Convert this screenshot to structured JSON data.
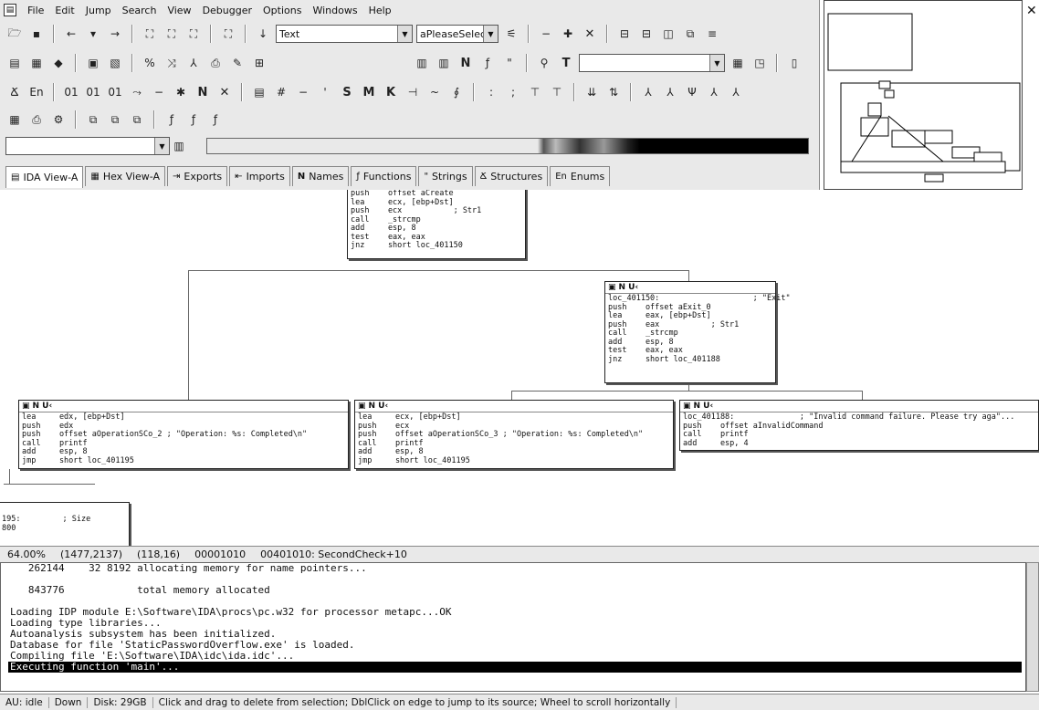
{
  "menu": [
    "File",
    "Edit",
    "Jump",
    "Search",
    "View",
    "Debugger",
    "Options",
    "Windows",
    "Help"
  ],
  "toolbar": {
    "text_combo": "Text",
    "select_combo": "aPleaseSelect"
  },
  "tabs": [
    {
      "label": "IDA View-A",
      "icon": "view-icon",
      "glyph": "▤"
    },
    {
      "label": "Hex View-A",
      "icon": "hex-icon",
      "glyph": "▦"
    },
    {
      "label": "Exports",
      "icon": "exports-icon",
      "glyph": "⇥"
    },
    {
      "label": "Imports",
      "icon": "imports-icon",
      "glyph": "⇤"
    },
    {
      "label": "Names",
      "icon": "names-icon",
      "glyph": "N"
    },
    {
      "label": "Functions",
      "icon": "functions-icon",
      "glyph": "ƒ"
    },
    {
      "label": "Strings",
      "icon": "strings-icon",
      "glyph": "\""
    },
    {
      "label": "Structures",
      "icon": "structures-icon",
      "glyph": "Ճ"
    },
    {
      "label": "Enums",
      "icon": "enums-icon",
      "glyph": "En"
    }
  ],
  "nodes": {
    "top": {
      "code": "push    offset aCreate\nlea     ecx, [ebp+Dst]\npush    ecx           ; Str1\ncall    _strcmp\nadd     esp, 8\ntest    eax, eax\njnz     short loc_401150"
    },
    "right": {
      "header": "N U‹",
      "code": "loc_401150:                    ; \"Exit\"\npush    offset aExit_0\nlea     eax, [ebp+Dst]\npush    eax           ; Str1\ncall    _strcmp\nadd     esp, 8\ntest    eax, eax\njnz     short loc_401188"
    },
    "left": {
      "header": "N U‹",
      "code": "lea     edx, [ebp+Dst]\npush    edx\npush    offset aOperationSCo_2 ; \"Operation: %s: Completed\\n\"\ncall    printf\nadd     esp, 8\njmp     short loc_401195"
    },
    "mid": {
      "header": "N U‹",
      "code": "lea     ecx, [ebp+Dst]\npush    ecx\npush    offset aOperationSCo_3 ; \"Operation: %s: Completed\\n\"\ncall    printf\nadd     esp, 8\njmp     short loc_401195"
    },
    "far": {
      "header": "N U‹",
      "code": "loc_401188:              ; \"Invalid command failure. Please try aga\"...\npush    offset aInvalidCommand\ncall    printf\nadd     esp, 4"
    },
    "bottom": {
      "code": "195:         ; Size\n800"
    }
  },
  "status1": {
    "zoom": "64.00%",
    "coords": "(1477,2137)",
    "cursor": "(118,16)",
    "offset": "00001010",
    "location": "00401010: SecondCheck+10"
  },
  "output": {
    "lines": [
      "   262144    32 8192 allocating memory for name pointers...",
      "",
      "   843776            total memory allocated",
      "",
      "Loading IDP module E:\\Software\\IDA\\procs\\pc.w32 for processor metapc...OK",
      "Loading type libraries...",
      "Autoanalysis subsystem has been initialized.",
      "Database for file 'StaticPasswordOverflow.exe' is loaded.",
      "Compiling file 'E:\\Software\\IDA\\idc\\ida.idc'..."
    ],
    "selected": "Executing function 'main'..."
  },
  "status2": {
    "au": "AU: idle",
    "direction": "Down",
    "disk": "Disk: 29GB",
    "hint": "Click and drag to delete from selection; DblClick on edge to jump to its source; Wheel to scroll horizontally"
  }
}
